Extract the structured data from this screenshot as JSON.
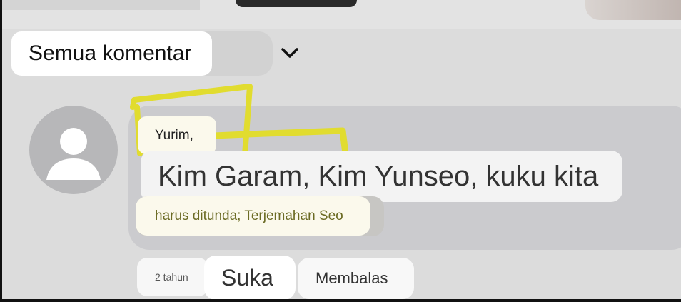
{
  "filter": {
    "label": "Semua komentar",
    "icon": "chevron-down-icon"
  },
  "comment": {
    "avatar_icon": "default-avatar-icon",
    "author": "Yurim,",
    "text_line1": "Kim Garam, Kim Yunseo, kuku kita",
    "text_line2": "harus ditunda; Terjemahan Seo",
    "time": "2 tahun",
    "like_label": "Suka",
    "reply_label": "Membalas"
  },
  "colors": {
    "highlight": "#e1dc2f",
    "bubble": "#cbcbce"
  }
}
